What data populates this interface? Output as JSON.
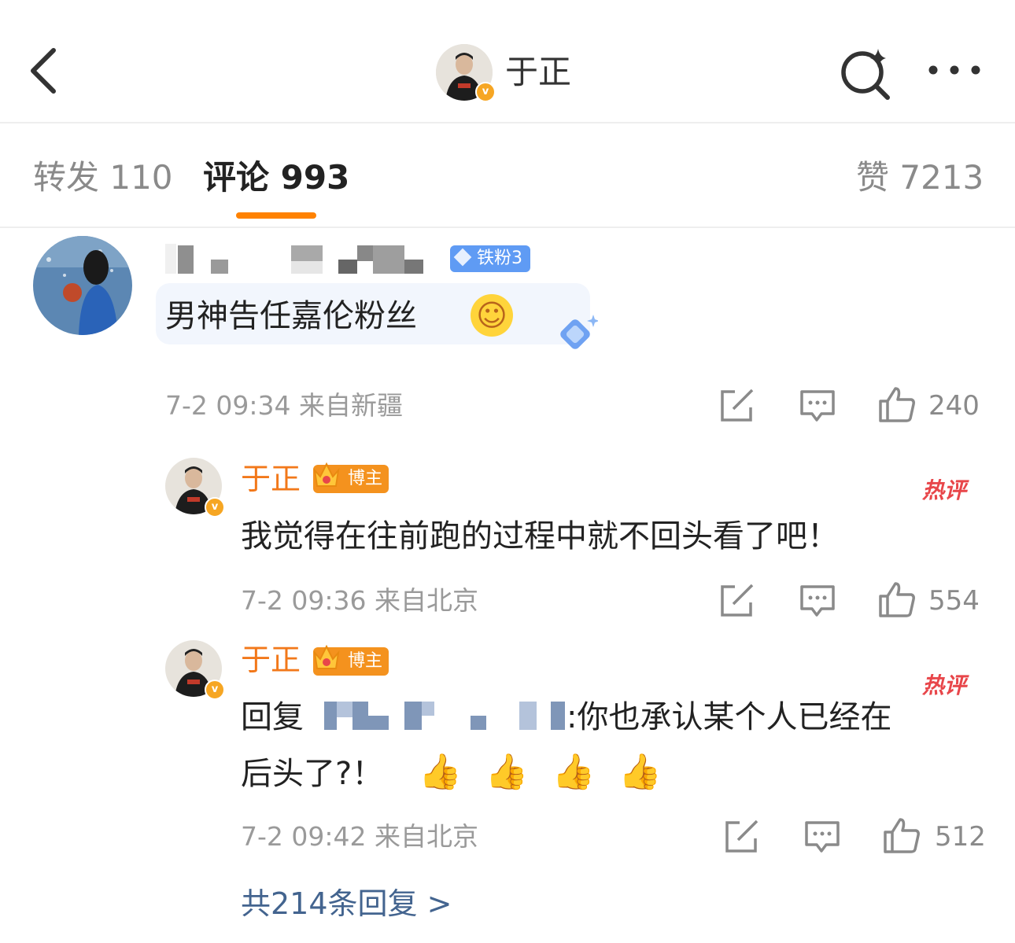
{
  "header": {
    "title": "于正",
    "back_icon": "chevron-left-icon",
    "search_icon": "search-sparkle-icon",
    "more_icon": "more-dots-icon"
  },
  "tabs": [
    {
      "label": "转发 110"
    },
    {
      "label": "评论 993"
    },
    {
      "label": "赞 7213"
    }
  ],
  "accent": "#ff8200",
  "comments": [
    {
      "badge": "铁粉3",
      "text": "男神告任嘉伦粉丝",
      "emoji": "☺",
      "meta": "7-2 09:34 来自新疆",
      "likes": "240"
    }
  ],
  "replies": [
    {
      "name": "于正",
      "badge": "博主",
      "hot": "热评",
      "text": "我觉得在往前跑的过程中就不回头看了吧！",
      "meta": "7-2 09:36 来自北京",
      "likes": "554"
    },
    {
      "name": "于正",
      "badge": "博主",
      "hot": "热评",
      "reply_prefix": "回复",
      "text_line1": ":你也承认某个人已经在",
      "text_line2": "后头了?！",
      "emojis": "👍 👍 👍 👍",
      "meta": "7-2 09:42 来自北京",
      "likes": "512"
    }
  ],
  "more_replies": "共214条回复 >"
}
